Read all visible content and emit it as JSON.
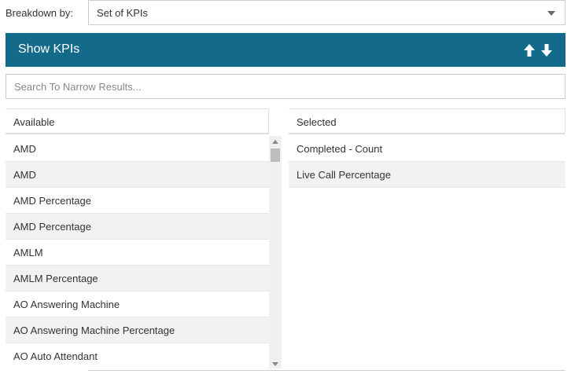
{
  "breakdown": {
    "label": "Breakdown by:",
    "selected": "Set of KPIs"
  },
  "kpi_panel": {
    "title": "Show KPIs",
    "icons": [
      "arrow-up-icon",
      "arrow-down-icon"
    ],
    "accent_color": "#136a8a"
  },
  "search": {
    "placeholder": "Search To Narrow Results..."
  },
  "available": {
    "header": "Available",
    "items": [
      "AMD",
      "AMD",
      "AMD Percentage",
      "AMD Percentage",
      "AMLM",
      "AMLM Percentage",
      "AO Answering Machine",
      "AO Answering Machine Percentage",
      "AO Auto Attendant"
    ]
  },
  "selected": {
    "header": "Selected",
    "items": [
      "Completed - Count",
      "Live Call Percentage"
    ]
  }
}
